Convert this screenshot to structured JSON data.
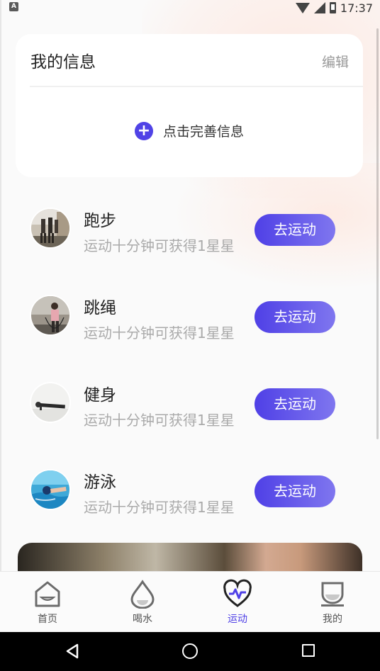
{
  "status_bar": {
    "app_icon_letter": "A",
    "time": "17:37",
    "icons": [
      "wifi-icon",
      "signal-icon",
      "battery-icon"
    ]
  },
  "info_card": {
    "title": "我的信息",
    "edit_label": "编辑",
    "add_label": "点击完善信息",
    "add_icon": "plus-circle-icon",
    "accent_color": "#5043e6"
  },
  "exercises": [
    {
      "name": "跑步",
      "desc": "运动十分钟可获得1星星",
      "button": "去运动"
    },
    {
      "name": "跳绳",
      "desc": "运动十分钟可获得1星星",
      "button": "去运动"
    },
    {
      "name": "健身",
      "desc": "运动十分钟可获得1星星",
      "button": "去运动"
    },
    {
      "name": "游泳",
      "desc": "运动十分钟可获得1星星",
      "button": "去运动"
    }
  ],
  "tabs": [
    {
      "label": "首页",
      "icon": "home-icon",
      "active": false
    },
    {
      "label": "喝水",
      "icon": "water-drop-icon",
      "active": false
    },
    {
      "label": "运动",
      "icon": "heart-pulse-icon",
      "active": true
    },
    {
      "label": "我的",
      "icon": "cup-icon",
      "active": false
    }
  ],
  "colors": {
    "accent": "#4f40e6",
    "button_gradient_end": "#7f76ef",
    "muted_text": "#aaaaaa"
  },
  "nav_bar": {
    "icons": [
      "back-icon",
      "home-circle-icon",
      "recents-icon"
    ]
  }
}
